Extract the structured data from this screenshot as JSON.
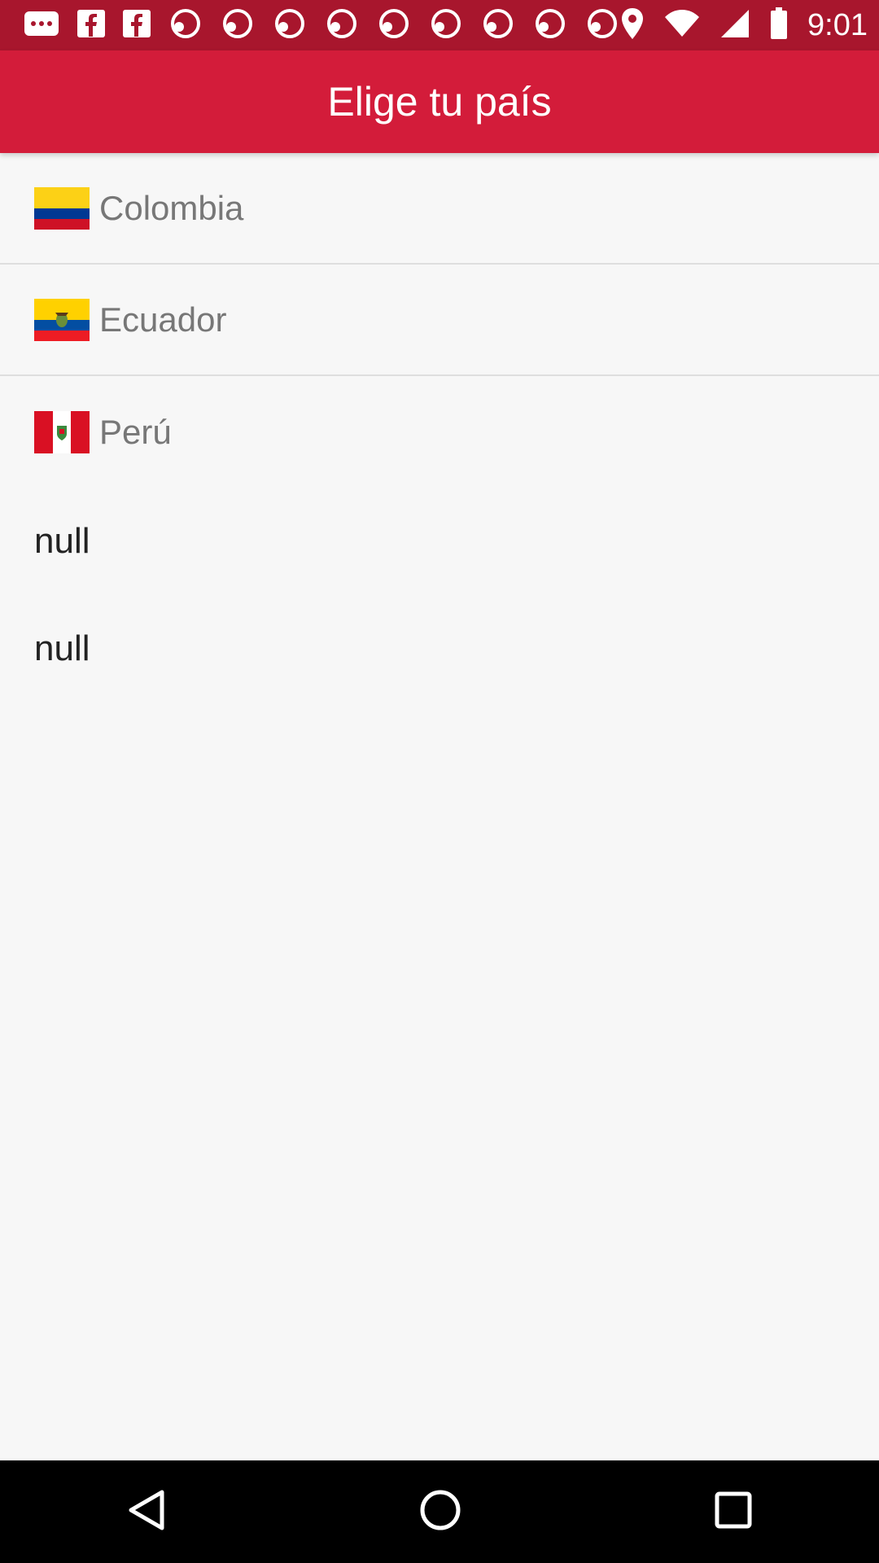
{
  "status_bar": {
    "time": "9:01",
    "notification_icons": [
      "message-icon",
      "facebook-icon",
      "facebook-icon",
      "abc7-icon",
      "abc7-icon",
      "abc7-icon",
      "abc7-icon",
      "abc7-icon",
      "abc7-icon",
      "abc7-icon",
      "abc7-icon",
      "abc7-icon",
      "abc7-icon"
    ]
  },
  "app_bar": {
    "title": "Elige tu país"
  },
  "countries": [
    {
      "name": "Colombia",
      "flag_icon": "colombia-flag-icon"
    },
    {
      "name": "Ecuador",
      "flag_icon": "ecuador-flag-icon"
    },
    {
      "name": "Perú",
      "flag_icon": "peru-flag-icon"
    }
  ],
  "extra_items": [
    {
      "label": "null"
    },
    {
      "label": "null"
    }
  ],
  "colors": {
    "status_bar": "#a8162d",
    "app_bar": "#d31c3a",
    "background": "#f7f7f7"
  },
  "nav_bar": {
    "icons": [
      "back-icon",
      "home-icon",
      "recents-icon"
    ]
  }
}
